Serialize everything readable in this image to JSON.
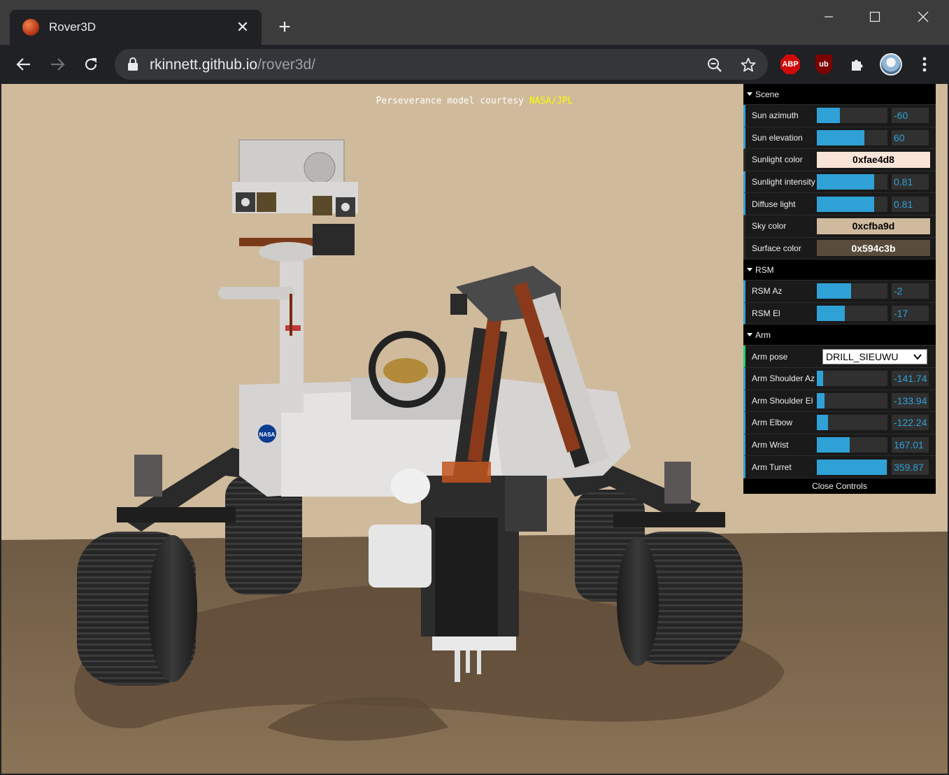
{
  "tab": {
    "title": "Rover3D",
    "close_glyph": "✕"
  },
  "new_tab_glyph": "+",
  "url": {
    "host": "rkinnett.github.io",
    "path": "/rover3d/"
  },
  "extensions": {
    "abp": "ABP",
    "ublock": "ub"
  },
  "credit": {
    "prefix": "Perseverance model courtesy ",
    "link": "NASA/JPL"
  },
  "gui": {
    "folders": {
      "scene": "Scene",
      "rsm": "RSM",
      "arm": "Arm"
    },
    "scene": {
      "sun_azimuth": {
        "label": "Sun azimuth",
        "value": "-60",
        "fill": 0.33
      },
      "sun_elevation": {
        "label": "Sun elevation",
        "value": "60",
        "fill": 0.67
      },
      "sunlight_color": {
        "label": "Sunlight color",
        "value": "0xfae4d8",
        "color": "#fae4d8"
      },
      "sunlight_intensity": {
        "label": "Sunlight intensity",
        "value": "0.81",
        "fill": 0.81
      },
      "diffuse_light": {
        "label": "Diffuse light",
        "value": "0.81",
        "fill": 0.81
      },
      "sky_color": {
        "label": "Sky color",
        "value": "0xcfba9d",
        "color": "#cfba9d"
      },
      "surface_color": {
        "label": "Surface color",
        "value": "0x594c3b",
        "color": "#594c3b"
      }
    },
    "rsm": {
      "az": {
        "label": "RSM Az",
        "value": "-2",
        "fill": 0.49
      },
      "el": {
        "label": "RSM El",
        "value": "-17",
        "fill": 0.4
      }
    },
    "arm": {
      "pose": {
        "label": "Arm pose",
        "value": "DRILL_SIEUWU"
      },
      "shoulder_az": {
        "label": "Arm Shoulder Az",
        "value": "-141.74",
        "fill": 0.09
      },
      "shoulder_el": {
        "label": "Arm Shoulder El",
        "value": "-133.94",
        "fill": 0.11
      },
      "elbow": {
        "label": "Arm Elbow",
        "value": "-122.24",
        "fill": 0.16
      },
      "wrist": {
        "label": "Arm Wrist",
        "value": "167.01",
        "fill": 0.47
      },
      "turret": {
        "label": "Arm Turret",
        "value": "359.87",
        "fill": 0.99
      }
    },
    "close_label": "Close Controls"
  },
  "colors": {
    "accent": "#2fa1d6",
    "sky": "#cfba9d",
    "surface": "#594c3b"
  }
}
